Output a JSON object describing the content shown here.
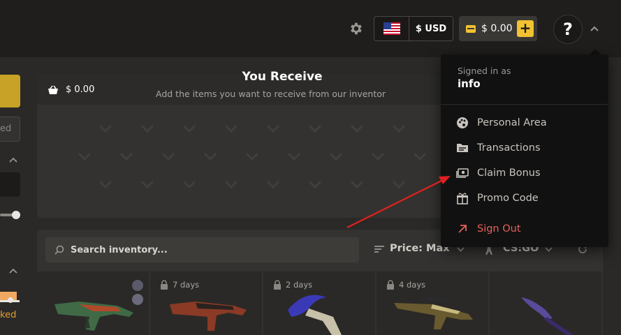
{
  "header": {
    "currency_code": "$ USD",
    "balance": "$ 0.00",
    "plus_label": "+",
    "help_label": "?"
  },
  "sidebar": {
    "input_fragment": "ed",
    "status_fragment": "ked"
  },
  "receive": {
    "amount": "$ 0.00",
    "title": "You Receive",
    "subtitle": "Add the items you want to receive from our inventor"
  },
  "inventory": {
    "search_placeholder": "Search inventory...",
    "sort_label": "Price: Max",
    "game_label": "CS:GO",
    "items": [
      {
        "lock_days": "",
        "weapon": "ak47-green"
      },
      {
        "lock_days": "7 days",
        "weapon": "m4-red"
      },
      {
        "lock_days": "2 days",
        "weapon": "karambit-blue"
      },
      {
        "lock_days": "4 days",
        "weapon": "awp-camo"
      },
      {
        "lock_days": "",
        "weapon": "knife-purple"
      }
    ]
  },
  "user_menu": {
    "signed_in_label": "Signed in as",
    "username": "info",
    "items": [
      {
        "label": "Personal Area",
        "icon": "palette-icon"
      },
      {
        "label": "Transactions",
        "icon": "folder-icon"
      },
      {
        "label": "Claim Bonus",
        "icon": "cash-icon"
      },
      {
        "label": "Promo Code",
        "icon": "gift-icon"
      },
      {
        "label": "Sign Out",
        "icon": "arrow-up-right-icon"
      }
    ]
  },
  "colors": {
    "accent": "#f2c230",
    "danger": "#e8605a",
    "annotation_arrow": "#e02020"
  }
}
